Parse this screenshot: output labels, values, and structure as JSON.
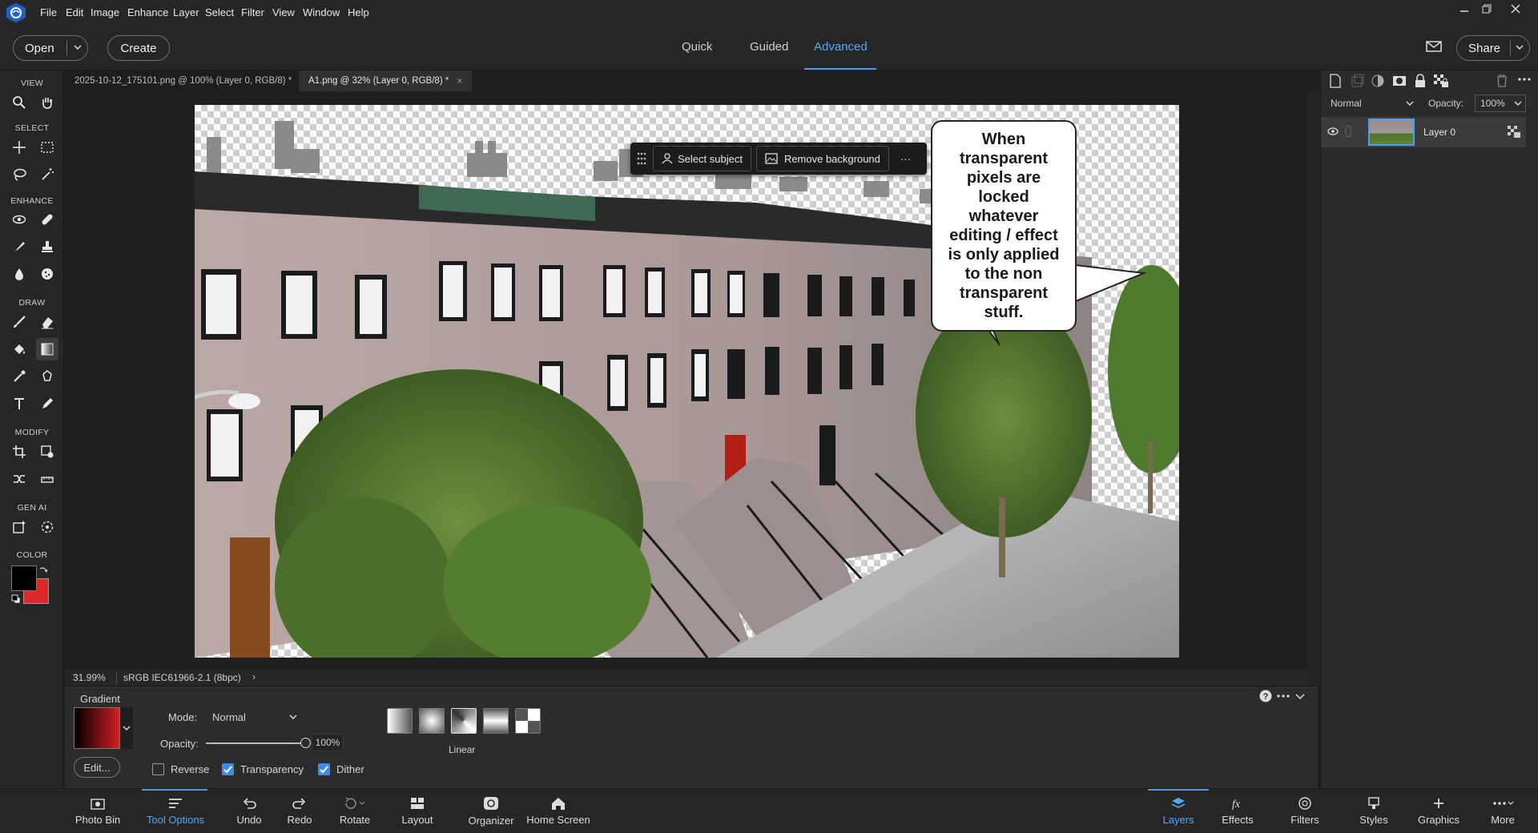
{
  "menu": [
    "File",
    "Edit",
    "Image",
    "Enhance",
    "Layer",
    "Select",
    "Filter",
    "View",
    "Window",
    "Help"
  ],
  "header": {
    "open_label": "Open",
    "create_label": "Create",
    "modes": [
      "Quick",
      "Guided",
      "Advanced"
    ],
    "active_mode": "Advanced",
    "share_label": "Share"
  },
  "toolbar": {
    "sections": [
      "VIEW",
      "SELECT",
      "ENHANCE",
      "DRAW",
      "MODIFY",
      "GEN AI",
      "COLOR"
    ],
    "foreground_color": "#000000",
    "background_color": "#e0282a"
  },
  "doc_tabs": [
    {
      "title": "2025-10-12_175101.png @ 100% (Layer 0, RGB/8) *",
      "close": "×"
    },
    {
      "title": "A1.png @ 32% (Layer 0, RGB/8) *",
      "close": "×"
    }
  ],
  "context_bar": {
    "select_subject": "Select subject",
    "remove_background": "Remove background",
    "more": "···"
  },
  "bubble_text": "When transparent pixels are locked whatever editing / effect is only applied to the non transparent stuff.",
  "status": {
    "zoom": "31.99%",
    "profile": "sRGB IEC61966-2.1 (8bpc)",
    "arrow": "›"
  },
  "tool_options": {
    "title": "Gradient",
    "edit_label": "Edit...",
    "mode_label": "Mode:",
    "mode_value": "Normal",
    "opacity_label": "Opacity:",
    "opacity_value": "100%",
    "opacity_percent": 100,
    "reverse_label": "Reverse",
    "reverse_checked": false,
    "transparency_label": "Transparency",
    "transparency_checked": true,
    "dither_label": "Dither",
    "dither_checked": true,
    "gradient_type_label": "Linear",
    "gradient_types": [
      "linear",
      "radial",
      "angle",
      "reflected",
      "diamond"
    ],
    "selected_type": "angle"
  },
  "layers_panel": {
    "blend_mode": "Normal",
    "opacity_label": "Opacity:",
    "opacity_value": "100%",
    "layers": [
      {
        "name": "Layer 0",
        "visible": true
      }
    ]
  },
  "bottom_bar": {
    "left": [
      "Photo Bin",
      "Tool Options",
      "Undo",
      "Redo",
      "Rotate",
      "Layout",
      "Organizer",
      "Home Screen"
    ],
    "left_active": "Tool Options",
    "right": [
      "Layers",
      "Effects",
      "Filters",
      "Styles",
      "Graphics",
      "More"
    ],
    "right_active": "Layers"
  },
  "colors": {
    "accent": "#4a9ef0",
    "checkbox_checked": "#3b8ef0"
  }
}
